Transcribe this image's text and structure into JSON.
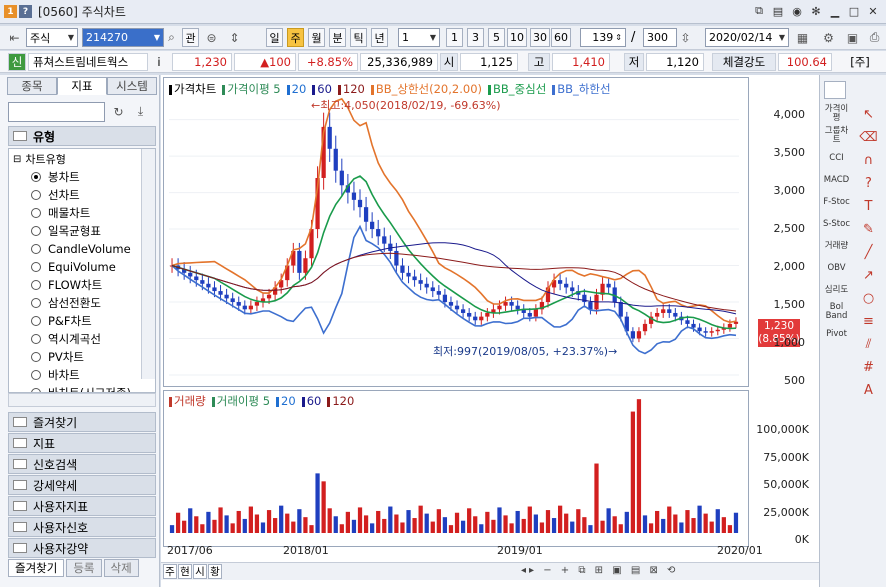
{
  "window": {
    "badge1": "1",
    "badge2": "?",
    "title": "[0560] 주식차트",
    "controls": [
      "▣",
      "▭",
      "✕"
    ]
  },
  "toolbar": {
    "market": "주식",
    "code": "214270",
    "btn_gwan": "관",
    "periods": [
      "일",
      "주",
      "월",
      "분",
      "틱",
      "년"
    ],
    "active_period": "주",
    "interval_value": "1",
    "quick_intervals": [
      "1",
      "3",
      "5",
      "10",
      "30",
      "60"
    ],
    "count_value": "139",
    "slash": "/",
    "total_value": "300",
    "date_value": "2020/02/14"
  },
  "quote": {
    "sin_label": "신",
    "name": "퓨쳐스트림네트웍스",
    "info_icon": "i",
    "price": "1,230",
    "change": "▲100",
    "change_pct": "+8.85%",
    "volume": "25,336,989",
    "open_label": "시",
    "open": "1,125",
    "high_label": "고",
    "high": "1,410",
    "low_label": "저",
    "low": "1,120",
    "strength_label": "체결강도",
    "strength": "100.64",
    "unit_tag": "[주]"
  },
  "left_panel": {
    "tabs": [
      "종목",
      "지표",
      "시스템"
    ],
    "active_tab": "지표",
    "group_title": "유형",
    "tree_root": "차트유형",
    "chart_types": [
      "봉차트",
      "선차트",
      "매물차트",
      "일목균형표",
      "CandleVolume",
      "EquiVolume",
      "FLOW차트",
      "삼선전환도",
      "P&F차트",
      "역시계곡선",
      "PV차트",
      "바차트",
      "바차트(시고저종)"
    ],
    "selected_type": "봉차트",
    "sections": [
      "즐겨찾기",
      "지표",
      "신호검색",
      "강세약세",
      "사용자지표",
      "사용자신호",
      "사용자강약"
    ],
    "bottom_tabs": [
      "즐겨찾기",
      "등록",
      "삭제"
    ]
  },
  "price_pane": {
    "legend": [
      {
        "label": "가격차트",
        "color": "#000000"
      },
      {
        "label": "가격이평 5",
        "color": "#2e8b57"
      },
      {
        "label": "20",
        "color": "#1f6fd1"
      },
      {
        "label": "60",
        "color": "#1a1a8c"
      },
      {
        "label": "120",
        "color": "#8b1a1a"
      },
      {
        "label": "BB_상한선(20,2.00)",
        "color": "#e3742c"
      },
      {
        "label": "BB_중심선",
        "color": "#1a9b4b"
      },
      {
        "label": "BB_하한선",
        "color": "#3d6fcf"
      }
    ],
    "y_ticks": [
      "4,000",
      "3,500",
      "3,000",
      "2,500",
      "2,000",
      "1,500",
      "1,000",
      "500"
    ],
    "high_annotation": "←최고:4,050(2018/02/19, -69.63%)",
    "low_annotation": "최저:997(2019/08/05, +23.37%)→",
    "last_price_tag": [
      "1,230",
      "(8.85%)"
    ]
  },
  "volume_pane": {
    "legend": [
      {
        "label": "거래량",
        "color": "#c0392b"
      },
      {
        "label": "거래이평 5",
        "color": "#2e8b57"
      },
      {
        "label": "20",
        "color": "#1f6fd1"
      },
      {
        "label": "60",
        "color": "#1a1a8c"
      },
      {
        "label": "120",
        "color": "#8b1a1a"
      }
    ],
    "y_ticks": [
      "100,000K",
      "75,000K",
      "50,000K",
      "25,000K",
      "0K"
    ]
  },
  "x_ticks": [
    "2017/06",
    "2018/01",
    "2019/01",
    "2020/01"
  ],
  "chart_bottom": {
    "left_buttons": [
      "주",
      "현",
      "시",
      "황"
    ]
  },
  "right_tools": {
    "col1": [
      "가격이평",
      "그룹차트",
      "CCI",
      "MACD",
      "F-Stoc",
      "S-Stoc",
      "거래량",
      "OBV",
      "심리도",
      "Bol Band",
      "Pivot"
    ],
    "col2_icons": [
      "cursor-icon",
      "eraser-icon",
      "magnet-icon",
      "help-icon",
      "text-icon",
      "pen-icon",
      "line-icon",
      "ray-icon",
      "circle-icon",
      "fibo-icon",
      "channel-icon",
      "grid-icon",
      "auto-icon"
    ]
  },
  "chart_data": [
    {
      "type": "candlestick",
      "title": "가격차트",
      "x_range": [
        "2017/06",
        "2020/02"
      ],
      "ylim": [
        500,
        4200
      ],
      "y_ticks": [
        4000,
        3500,
        3000,
        2500,
        2000,
        1500,
        1000,
        500
      ],
      "high": {
        "value": 4050,
        "date": "2018/02/19"
      },
      "low": {
        "value": 997,
        "date": "2019/08/05"
      },
      "last": 1230,
      "close_series": [
        2000,
        1950,
        1900,
        1850,
        1800,
        1750,
        1700,
        1650,
        1600,
        1550,
        1500,
        1450,
        1400,
        1450,
        1500,
        1550,
        1600,
        1700,
        1800,
        2000,
        2200,
        1900,
        2100,
        2500,
        3200,
        3900,
        3600,
        3300,
        3100,
        3000,
        2900,
        2800,
        2600,
        2500,
        2400,
        2300,
        2200,
        2000,
        1900,
        1850,
        1800,
        1750,
        1700,
        1650,
        1600,
        1500,
        1450,
        1400,
        1350,
        1300,
        1250,
        1300,
        1350,
        1400,
        1450,
        1500,
        1450,
        1400,
        1350,
        1300,
        1400,
        1500,
        1700,
        1800,
        1750,
        1700,
        1650,
        1600,
        1500,
        1400,
        1600,
        1750,
        1700,
        1500,
        1300,
        1100,
        1000,
        1100,
        1200,
        1300,
        1350,
        1400,
        1350,
        1300,
        1250,
        1200,
        1150,
        1100,
        1080,
        1100,
        1120,
        1150,
        1200,
        1230
      ]
    },
    {
      "type": "bar",
      "title": "거래량",
      "ylim": [
        0,
        125000
      ],
      "y_ticks": [
        100000,
        75000,
        50000,
        25000,
        0
      ],
      "unit": "K"
    }
  ]
}
